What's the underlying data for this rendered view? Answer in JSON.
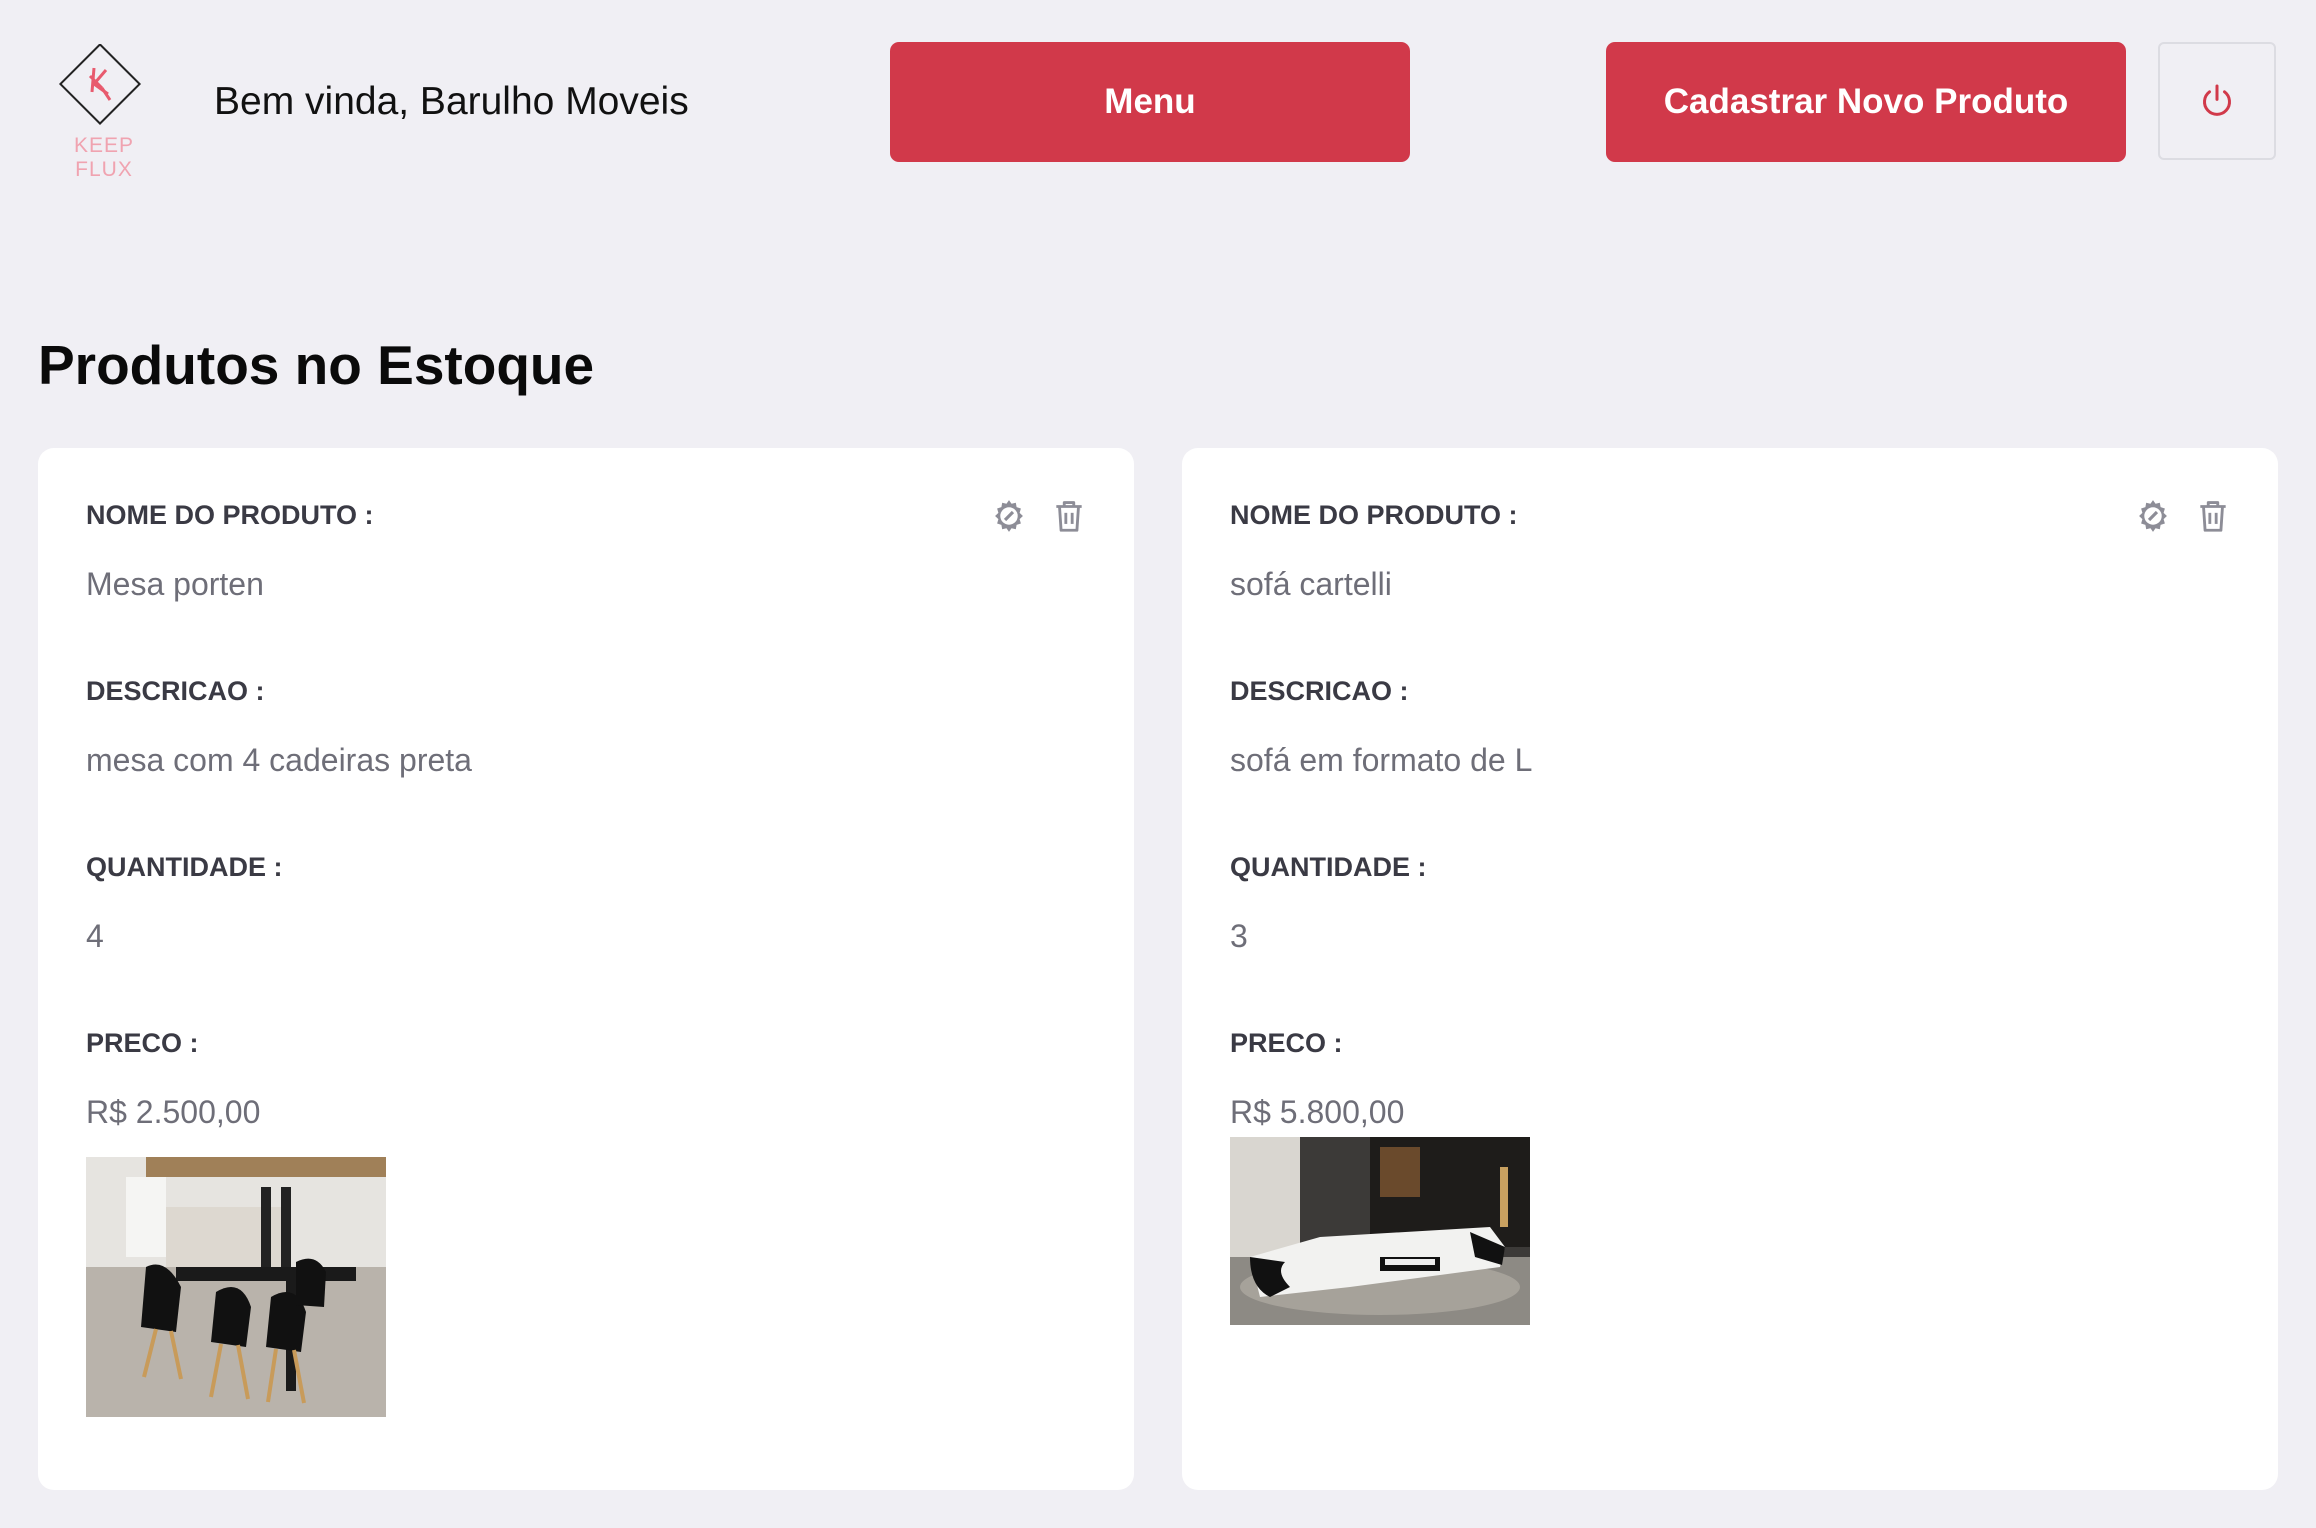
{
  "header": {
    "logo_text": "KEEP FLUX",
    "welcome": "Bem vinda, Barulho Moveis",
    "menu_label": "Menu",
    "new_product_label": "Cadastrar Novo Produto",
    "power_icon": "power-icon"
  },
  "main": {
    "title": "Produtos no Estoque"
  },
  "products": [
    {
      "name_label": "NOME DO PRODUTO :",
      "name": "Mesa porten",
      "desc_label": "DESCRICAO :",
      "desc": "mesa com 4 cadeiras preta",
      "qty_label": "QUANTIDADE :",
      "qty": "4",
      "price_label": "PRECO :",
      "price": "R$ 2.500,00",
      "image": "dining-table-photo",
      "edit_icon": "gear-icon",
      "delete_icon": "trash-icon"
    },
    {
      "name_label": "NOME DO PRODUTO :",
      "name": "sofá cartelli",
      "desc_label": "DESCRICAO :",
      "desc": "sofá em formato de L",
      "qty_label": "QUANTIDADE :",
      "qty": "3",
      "price_label": "PRECO :",
      "price": "R$ 5.800,00",
      "image": "sofa-photo",
      "edit_icon": "gear-icon",
      "delete_icon": "trash-icon"
    }
  ],
  "colors": {
    "accent": "#d1394a",
    "background": "#f0eff4",
    "card": "#ffffff",
    "label": "#3a3a44",
    "value": "#6e6e78"
  }
}
